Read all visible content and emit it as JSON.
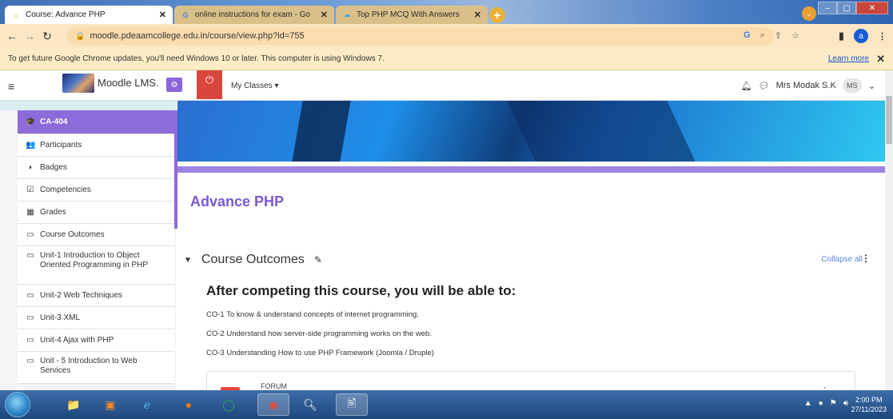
{
  "browser": {
    "tabs": [
      {
        "title": "Course: Advance PHP",
        "active": true,
        "icon": "moodle-icon"
      },
      {
        "title": "online instructions for exam - Go",
        "active": false,
        "icon": "google-icon"
      },
      {
        "title": "Top PHP MCQ With Answers",
        "active": false,
        "icon": "cloud-icon"
      }
    ],
    "url": "moodle.pdeaamcollege.edu.in/course/view.php?id=755",
    "profile_initial": "a",
    "infobar_text": "To get future Google Chrome updates, you'll need Windows 10 or later. This computer is using Windows 7.",
    "learn_more": "Learn more"
  },
  "moodle": {
    "logo_text": "Moodle LMS.",
    "my_classes": "My Classes ▾",
    "user_name": "Mrs Modak S.K",
    "user_initials": "MS"
  },
  "sidebar": {
    "items": [
      {
        "label": "CA-404",
        "icon": "graduation-cap-icon",
        "glyph": "🎓"
      },
      {
        "label": "Participants",
        "icon": "users-icon",
        "glyph": "👥"
      },
      {
        "label": "Badges",
        "icon": "shield-icon",
        "glyph": "◗"
      },
      {
        "label": "Competencies",
        "icon": "checkbox-icon",
        "glyph": "☑"
      },
      {
        "label": "Grades",
        "icon": "table-icon",
        "glyph": "▦"
      },
      {
        "label": "Course Outcomes",
        "icon": "folder-icon",
        "glyph": "▭"
      },
      {
        "label": "Unit-1 Introduction to Object Oriented Programming in PHP",
        "icon": "folder-icon",
        "glyph": "▭"
      },
      {
        "label": "Unit-2 Web Techniques",
        "icon": "folder-icon",
        "glyph": "▭"
      },
      {
        "label": "Unit-3 XML",
        "icon": "folder-icon",
        "glyph": "▭"
      },
      {
        "label": "Unit-4 Ajax with PHP",
        "icon": "folder-icon",
        "glyph": "▭"
      },
      {
        "label": "Unit - 5 Introduction to Web Services",
        "icon": "folder-icon",
        "glyph": "▭"
      }
    ]
  },
  "course": {
    "title": "Advance PHP",
    "section_title": "Course Outcomes",
    "collapse_all": "Collapse all",
    "outcomes_heading": "After competing this course, you will be able to:",
    "outcomes": [
      "CO-1 To know & understand concepts of internet programming.",
      "CO-2 Understand how server-side programming works on the web.",
      "CO-3 Understanding How to use PHP Framework (Joomla / Druple)"
    ],
    "activity_label": "FORUM"
  },
  "taskbar": {
    "time": "2:00 PM",
    "date": "27/11/2023"
  },
  "colors": {
    "accent": "#8d6bd8",
    "title": "#7a58d2",
    "power": "#d9463d"
  }
}
